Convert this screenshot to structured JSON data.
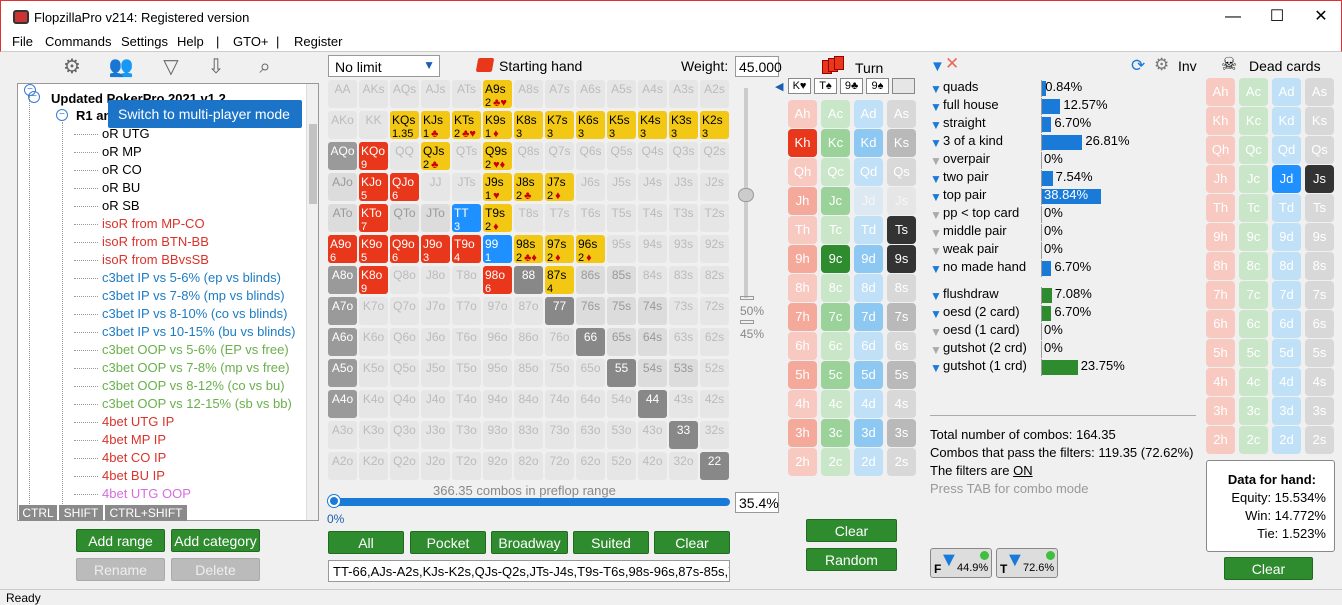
{
  "window": {
    "title": "FlopzillaPro v214: Registered version",
    "controls": [
      "—",
      "☐",
      "✕"
    ]
  },
  "menu": [
    "File",
    "Commands",
    "Settings",
    "Help",
    "|",
    "GTO+",
    "|",
    "Register"
  ],
  "toolbar": {
    "icons": [
      "gear-icon",
      "users-icon",
      "filter-add-icon",
      "import-icon",
      "search-icon"
    ]
  },
  "tooltip": "Switch to multi-player mode",
  "tree": {
    "root": "Updated PokerPro 2021 v1.2",
    "group": "R1 and",
    "items": [
      {
        "label": "oR UTG",
        "color": "#000"
      },
      {
        "label": "oR MP",
        "color": "#000"
      },
      {
        "label": "oR CO",
        "color": "#000"
      },
      {
        "label": "oR BU",
        "color": "#000"
      },
      {
        "label": "oR SB",
        "color": "#000"
      },
      {
        "label": "isoR from MP-CO",
        "color": "#d9342b"
      },
      {
        "label": "isoR from BTN-BB",
        "color": "#d9342b"
      },
      {
        "label": "isoR from BBvsSB",
        "color": "#d9342b"
      },
      {
        "label": "c3bet IP vs 5-6% (ep vs blinds)",
        "color": "#1d7cc4"
      },
      {
        "label": "c3bet IP vs 7-8% (mp vs blinds)",
        "color": "#1d7cc4"
      },
      {
        "label": "c3bet IP vs 8-10% (co vs blinds)",
        "color": "#1d7cc4"
      },
      {
        "label": "c3bet IP vs 10-15% (bu vs blinds)",
        "color": "#1d7cc4"
      },
      {
        "label": "c3bet OOP vs 5-6% (EP vs free)",
        "color": "#6ab04c"
      },
      {
        "label": "c3bet OOP vs 7-8% (mp vs free)",
        "color": "#6ab04c"
      },
      {
        "label": "c3bet OOP vs 8-12% (co vs bu)",
        "color": "#6ab04c"
      },
      {
        "label": "c3bet OOP vs 12-15% (sb vs bb)",
        "color": "#6ab04c"
      },
      {
        "label": "4bet UTG IP",
        "color": "#d9342b"
      },
      {
        "label": "4bet MP IP",
        "color": "#d9342b"
      },
      {
        "label": "4bet CO IP",
        "color": "#d9342b"
      },
      {
        "label": "4bet BU IP",
        "color": "#d9342b"
      },
      {
        "label": "4bet UTG OOP",
        "color": "#d66ee0"
      }
    ]
  },
  "modifiers": [
    "CTRL",
    "SHIFT",
    "CTRL+SHIFT"
  ],
  "left_buttons": {
    "add_range": "Add range",
    "add_category": "Add category",
    "rename": "Rename",
    "delete": "Delete"
  },
  "range": {
    "limit": "No limit",
    "starting_hand": "Starting hand",
    "weight_label": "Weight:",
    "weight_value": "45.000",
    "slider_top": "50%",
    "slider_bottom": "45%",
    "combos_text": "366.35 combos in preflop range",
    "progress_start": "0%",
    "progress_pct": "35.4%",
    "progress_fraction": 0.354,
    "buttons": {
      "all": "All",
      "pocket": "Pocket",
      "broadway": "Broadway",
      "suited": "Suited",
      "clear": "Clear"
    },
    "range_text": "TT-66,AJs-A2s,KJs-K2s,QJs-Q2s,JTs-J4s,T9s-T6s,98s-96s,87s-85s,76"
  },
  "matrix": [
    [
      [
        "AA",
        "e"
      ],
      [
        "AKs",
        "e"
      ],
      [
        "AQs",
        "e"
      ],
      [
        "AJs",
        "e"
      ],
      [
        "ATs",
        "e"
      ],
      [
        "A9s",
        "y",
        "2",
        "♣♥"
      ],
      [
        "A8s",
        "e"
      ],
      [
        "A7s",
        "e"
      ],
      [
        "A6s",
        "e"
      ],
      [
        "A5s",
        "e"
      ],
      [
        "A4s",
        "e"
      ],
      [
        "A3s",
        "e"
      ],
      [
        "A2s",
        "e"
      ]
    ],
    [
      [
        "AKo",
        "e"
      ],
      [
        "KK",
        "e"
      ],
      [
        "KQs",
        "y",
        "1.35"
      ],
      [
        "KJs",
        "y",
        "1",
        "♣"
      ],
      [
        "KTs",
        "y",
        "2",
        "♣♥"
      ],
      [
        "K9s",
        "y",
        "1",
        "♦"
      ],
      [
        "K8s",
        "y",
        "3"
      ],
      [
        "K7s",
        "y",
        "3"
      ],
      [
        "K6s",
        "y",
        "3"
      ],
      [
        "K5s",
        "y",
        "3"
      ],
      [
        "K4s",
        "y",
        "3"
      ],
      [
        "K3s",
        "y",
        "3"
      ],
      [
        "K2s",
        "y",
        "3"
      ]
    ],
    [
      [
        "AQo",
        "g"
      ],
      [
        "KQo",
        "r",
        "9"
      ],
      [
        "QQ",
        "e"
      ],
      [
        "QJs",
        "y",
        "2",
        "♣"
      ],
      [
        "QTs",
        "e"
      ],
      [
        "Q9s",
        "y",
        "2",
        "♥♦"
      ],
      [
        "Q8s",
        "e"
      ],
      [
        "Q7s",
        "e"
      ],
      [
        "Q6s",
        "e"
      ],
      [
        "Q5s",
        "e"
      ],
      [
        "Q4s",
        "e"
      ],
      [
        "Q3s",
        "e"
      ],
      [
        "Q2s",
        "e"
      ]
    ],
    [
      [
        "AJo",
        "p"
      ],
      [
        "KJo",
        "r",
        "5"
      ],
      [
        "QJo",
        "r",
        "6"
      ],
      [
        "JJ",
        "e"
      ],
      [
        "JTs",
        "e"
      ],
      [
        "J9s",
        "y",
        "1",
        "♥"
      ],
      [
        "J8s",
        "y",
        "2",
        "♣"
      ],
      [
        "J7s",
        "y",
        "2",
        "♦"
      ],
      [
        "J6s",
        "e"
      ],
      [
        "J5s",
        "e"
      ],
      [
        "J4s",
        "e"
      ],
      [
        "J3s",
        "e"
      ],
      [
        "J2s",
        "e"
      ]
    ],
    [
      [
        "ATo",
        "p"
      ],
      [
        "KTo",
        "r",
        "7"
      ],
      [
        "QTo",
        "p"
      ],
      [
        "JTo",
        "p"
      ],
      [
        "TT",
        "b",
        "3"
      ],
      [
        "T9s",
        "y",
        "2",
        "♦"
      ],
      [
        "T8s",
        "e"
      ],
      [
        "T7s",
        "e"
      ],
      [
        "T6s",
        "e"
      ],
      [
        "T5s",
        "e"
      ],
      [
        "T4s",
        "e"
      ],
      [
        "T3s",
        "e"
      ],
      [
        "T2s",
        "e"
      ]
    ],
    [
      [
        "A9o",
        "r",
        "6"
      ],
      [
        "K9o",
        "r",
        "5"
      ],
      [
        "Q9o",
        "r",
        "6"
      ],
      [
        "J9o",
        "r",
        "3"
      ],
      [
        "T9o",
        "r",
        "4"
      ],
      [
        "99",
        "b",
        "1"
      ],
      [
        "98s",
        "y",
        "2",
        "♣♦"
      ],
      [
        "97s",
        "y",
        "2",
        "♦"
      ],
      [
        "96s",
        "y",
        "2",
        "♦"
      ],
      [
        "95s",
        "e"
      ],
      [
        "94s",
        "e"
      ],
      [
        "93s",
        "e"
      ],
      [
        "92s",
        "e"
      ]
    ],
    [
      [
        "A8o",
        "g"
      ],
      [
        "K8o",
        "r",
        "9"
      ],
      [
        "Q8o",
        "e"
      ],
      [
        "J8o",
        "e"
      ],
      [
        "T8o",
        "e"
      ],
      [
        "98o",
        "r",
        "6"
      ],
      [
        "88",
        "x"
      ],
      [
        "87s",
        "y",
        "4"
      ],
      [
        "86s",
        "p"
      ],
      [
        "85s",
        "p"
      ],
      [
        "84s",
        "e"
      ],
      [
        "83s",
        "e"
      ],
      [
        "82s",
        "e"
      ]
    ],
    [
      [
        "A7o",
        "g"
      ],
      [
        "K7o",
        "e"
      ],
      [
        "Q7o",
        "e"
      ],
      [
        "J7o",
        "e"
      ],
      [
        "T7o",
        "e"
      ],
      [
        "97o",
        "e"
      ],
      [
        "87o",
        "e"
      ],
      [
        "77",
        "x"
      ],
      [
        "76s",
        "p"
      ],
      [
        "75s",
        "p"
      ],
      [
        "74s",
        "p"
      ],
      [
        "73s",
        "e"
      ],
      [
        "72s",
        "e"
      ]
    ],
    [
      [
        "A6o",
        "g"
      ],
      [
        "K6o",
        "e"
      ],
      [
        "Q6o",
        "e"
      ],
      [
        "J6o",
        "e"
      ],
      [
        "T6o",
        "e"
      ],
      [
        "96o",
        "e"
      ],
      [
        "86o",
        "e"
      ],
      [
        "76o",
        "e"
      ],
      [
        "66",
        "x"
      ],
      [
        "65s",
        "p"
      ],
      [
        "64s",
        "p"
      ],
      [
        "63s",
        "e"
      ],
      [
        "62s",
        "e"
      ]
    ],
    [
      [
        "A5o",
        "g"
      ],
      [
        "K5o",
        "e"
      ],
      [
        "Q5o",
        "e"
      ],
      [
        "J5o",
        "e"
      ],
      [
        "T5o",
        "e"
      ],
      [
        "95o",
        "e"
      ],
      [
        "85o",
        "e"
      ],
      [
        "75o",
        "e"
      ],
      [
        "65o",
        "e"
      ],
      [
        "55",
        "x"
      ],
      [
        "54s",
        "p"
      ],
      [
        "53s",
        "p"
      ],
      [
        "52s",
        "e"
      ]
    ],
    [
      [
        "A4o",
        "g"
      ],
      [
        "K4o",
        "e"
      ],
      [
        "Q4o",
        "e"
      ],
      [
        "J4o",
        "e"
      ],
      [
        "T4o",
        "e"
      ],
      [
        "94o",
        "e"
      ],
      [
        "84o",
        "e"
      ],
      [
        "74o",
        "e"
      ],
      [
        "64o",
        "e"
      ],
      [
        "54o",
        "e"
      ],
      [
        "44",
        "x"
      ],
      [
        "43s",
        "e"
      ],
      [
        "42s",
        "e"
      ]
    ],
    [
      [
        "A3o",
        "e"
      ],
      [
        "K3o",
        "e"
      ],
      [
        "Q3o",
        "e"
      ],
      [
        "J3o",
        "e"
      ],
      [
        "T3o",
        "e"
      ],
      [
        "93o",
        "e"
      ],
      [
        "83o",
        "e"
      ],
      [
        "73o",
        "e"
      ],
      [
        "63o",
        "e"
      ],
      [
        "53o",
        "e"
      ],
      [
        "43o",
        "e"
      ],
      [
        "33",
        "x"
      ],
      [
        "32s",
        "e"
      ]
    ],
    [
      [
        "A2o",
        "e"
      ],
      [
        "K2o",
        "e"
      ],
      [
        "Q2o",
        "e"
      ],
      [
        "J2o",
        "e"
      ],
      [
        "T2o",
        "e"
      ],
      [
        "92o",
        "e"
      ],
      [
        "82o",
        "e"
      ],
      [
        "72o",
        "e"
      ],
      [
        "62o",
        "e"
      ],
      [
        "52o",
        "e"
      ],
      [
        "42o",
        "e"
      ],
      [
        "32o",
        "e"
      ],
      [
        "22",
        "x"
      ]
    ]
  ],
  "board": {
    "turn_label": "Turn",
    "turn_cards": [
      "K♥",
      "T♠",
      "9♣",
      "9♠",
      ""
    ],
    "clear": "Clear",
    "random": "Random",
    "cards": [
      [
        "Ah",
        "Ac",
        "Ad",
        "As"
      ],
      [
        "Kh",
        "Kc",
        "Kd",
        "Ks"
      ],
      [
        "Qh",
        "Qc",
        "Qd",
        "Qs"
      ],
      [
        "Jh",
        "Jc",
        "Jd",
        "Js"
      ],
      [
        "Th",
        "Tc",
        "Td",
        "Ts"
      ],
      [
        "9h",
        "9c",
        "9d",
        "9s"
      ],
      [
        "8h",
        "8c",
        "8d",
        "8s"
      ],
      [
        "7h",
        "7c",
        "7d",
        "7s"
      ],
      [
        "6h",
        "6c",
        "6d",
        "6s"
      ],
      [
        "5h",
        "5c",
        "5d",
        "5s"
      ],
      [
        "4h",
        "4c",
        "4d",
        "4s"
      ],
      [
        "3h",
        "3c",
        "3d",
        "3s"
      ],
      [
        "2h",
        "2c",
        "2d",
        "2s"
      ]
    ],
    "selected": [
      "Kh",
      "Ts",
      "9c",
      "9s"
    ],
    "dim": [
      "Jd",
      "Js"
    ]
  },
  "filters": {
    "made": [
      {
        "label": "quads",
        "pct": "0.84%",
        "value": 0.84
      },
      {
        "label": "full house",
        "pct": "12.57%",
        "value": 12.57
      },
      {
        "label": "straight",
        "pct": "6.70%",
        "value": 6.7
      },
      {
        "label": "3 of a kind",
        "pct": "26.81%",
        "value": 26.81
      },
      {
        "label": "overpair",
        "pct": "0%",
        "value": 0
      },
      {
        "label": "two pair",
        "pct": "7.54%",
        "value": 7.54
      },
      {
        "label": "top pair",
        "pct": "38.84%",
        "value": 38.84
      },
      {
        "label": "pp < top card",
        "pct": "0%",
        "value": 0
      },
      {
        "label": "middle pair",
        "pct": "0%",
        "value": 0
      },
      {
        "label": "weak pair",
        "pct": "0%",
        "value": 0
      },
      {
        "label": "no made hand",
        "pct": "6.70%",
        "value": 6.7
      }
    ],
    "draws": [
      {
        "label": "flushdraw",
        "pct": "7.08%",
        "value": 7.08
      },
      {
        "label": "oesd (2 card)",
        "pct": "6.70%",
        "value": 6.7
      },
      {
        "label": "oesd (1 card)",
        "pct": "0%",
        "value": 0
      },
      {
        "label": "gutshot (2 crd)",
        "pct": "0%",
        "value": 0
      },
      {
        "label": "gutshot (1 crd)",
        "pct": "23.75%",
        "value": 23.75
      }
    ],
    "inv": "Inv",
    "total": "Total number of combos: 164.35",
    "pass": "Combos that pass the filters: 119.35 (72.62%)",
    "filters_on_prefix": "The filters are ",
    "filters_on": "ON",
    "press_tab": "Press TAB for combo mode",
    "toggle_f": "44.9%",
    "toggle_t": "72.6%"
  },
  "dead": {
    "label": "Dead cards",
    "selected": [
      "Jd",
      "Js"
    ],
    "clear": "Clear",
    "data_title": "Data for hand:",
    "equity": "Equity: 15.534%",
    "win": "Win: 14.772%",
    "tie": "Tie: 1.523%"
  },
  "status": "Ready",
  "colors": {
    "accent": "#1e90ff",
    "hearts": "#e8371a",
    "clubs": "#2e8b2e",
    "diamonds": "#1e90ff",
    "spades": "#333333"
  }
}
